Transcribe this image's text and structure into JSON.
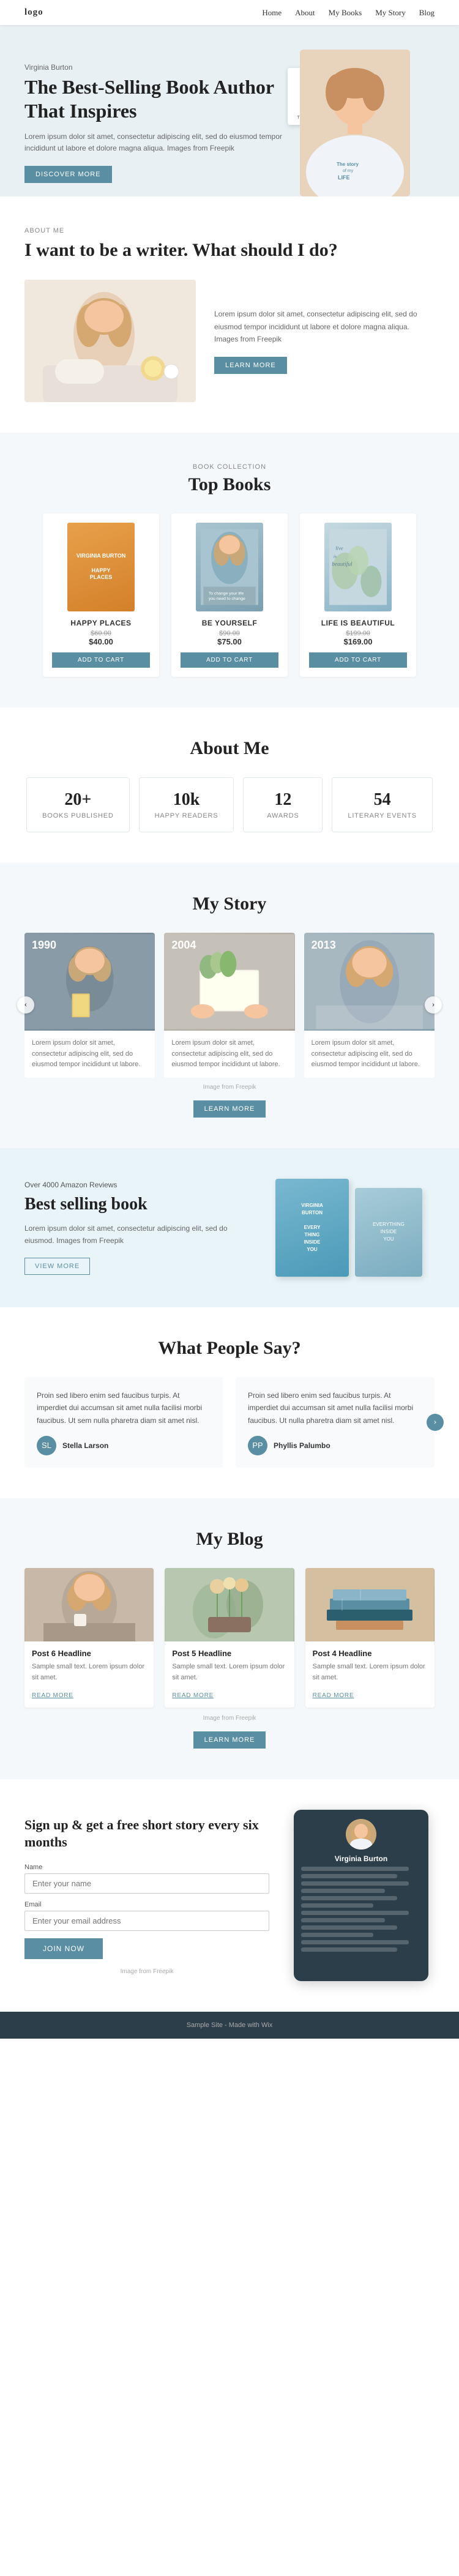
{
  "nav": {
    "logo": "logo",
    "links": [
      "Home",
      "About",
      "My Books",
      "My Story",
      "Blog"
    ]
  },
  "hero": {
    "subtitle": "Virginia Burton",
    "title": "The Best-Selling Book Author That Inspires",
    "body": "Lorem ipsum dolor sit amet, consectetur adipiscing elit, sed do eiusmod tempor incididunt ut labore et dolore magna aliqua. Images from Freepik",
    "cta": "DISCOVER MORE",
    "book_card_text": "The story of my LIFE"
  },
  "about1": {
    "label": "About Me",
    "heading": "I want to be a writer. What should I do?",
    "body": "Lorem ipsum dolor sit amet, consectetur adipiscing elit, sed do eiusmod tempor incididunt ut labore et dolore magna aliqua. Images from Freepik",
    "cta": "LEARN MORE"
  },
  "books": {
    "label": "Book Collection",
    "title": "Top Books",
    "items": [
      {
        "cover_text": "VIRGINIA BURTON\nHAPPY PLACES",
        "name": "HAPPY PLACES",
        "price_old": "$60.00",
        "price_new": "$40.00",
        "cta": "ADD TO CART"
      },
      {
        "cover_text": "To change your life\nyou need to change\nyour priorities",
        "name": "BE YOURSELF",
        "price_old": "$90.00",
        "price_new": "$75.00",
        "cta": "ADD TO CART"
      },
      {
        "cover_text": "live is beautiful",
        "name": "LIFE IS BEAUTIFUL",
        "price_old": "$199.00",
        "price_new": "$169.00",
        "cta": "ADD TO CART"
      }
    ]
  },
  "stats": {
    "title": "About Me",
    "items": [
      {
        "number": "20+",
        "label": "BOOKS PUBLISHED"
      },
      {
        "number": "10k",
        "label": "HAPPY READERS"
      },
      {
        "number": "12",
        "label": "AWARDS"
      },
      {
        "number": "54",
        "label": "LITERARY EVENTS"
      }
    ]
  },
  "story": {
    "title": "My Story",
    "slides": [
      {
        "year": "1990",
        "text": "Lorem ipsum dolor sit amet, consectetur adipiscing elit, sed do eiusmod tempor incididunt ut labore."
      },
      {
        "year": "2004",
        "text": "Lorem ipsum dolor sit amet, consectetur adipiscing elit, sed do eiusmod tempor incididunt ut labore."
      },
      {
        "year": "2013",
        "text": "Lorem ipsum dolor sit amet, consectetur adipiscing elit, sed do eiusmod tempor incididunt ut labore."
      }
    ],
    "image_note": "Image from Freepik",
    "cta": "LEARN MORE"
  },
  "bestsell": {
    "reviews": "Over 4000 Amazon Reviews",
    "title": "Best selling book",
    "body": "Lorem ipsum dolor sit amet, consectetur adipiscing elit, sed do eiusmod. Images from Freepik",
    "cta": "VIEW MORE",
    "book1_text": "VIRGINIA BURTON\n\nEVERYTHING INSIDE YOU",
    "book2_text": "EVERYTHING INSIDE YOU"
  },
  "testimonials": {
    "title": "What People Say?",
    "items": [
      {
        "text": "Proin sed libero enim sed faucibus turpis. At imperdiet dui accumsan sit amet nulla facilisi morbi faucibus. Ut sem nulla pharetra diam sit amet nisl.",
        "author": "Stella Larson",
        "initials": "SL"
      },
      {
        "text": "Proin sed libero enim sed faucibus turpis. At imperdiet dui accumsan sit amet nulla facilisi morbi faucibus. Ut nulla pharetra diam sit amet nisl.",
        "author": "Phyllis Palumbo",
        "initials": "PP"
      }
    ]
  },
  "blog": {
    "title": "My Blog",
    "posts": [
      {
        "headline": "Post 6 Headline",
        "text": "Sample small text. Lorem ipsum dolor sit amet.",
        "cta": "READ MORE"
      },
      {
        "headline": "Post 5 Headline",
        "text": "Sample small text. Lorem ipsum dolor sit amet.",
        "cta": "READ MORE"
      },
      {
        "headline": "Post 4 Headline",
        "text": "Sample small text. Lorem ipsum dolor sit amet.",
        "cta": "READ MORE"
      }
    ],
    "image_note": "Image from Freepik",
    "cta": "LEARN MORE"
  },
  "newsletter": {
    "title": "Sign up & get a free short story every six months",
    "name_label": "Name",
    "name_placeholder": "Enter your name",
    "email_label": "Email",
    "email_placeholder": "Enter your email address",
    "cta": "JOIN NOW",
    "image_note": "Image from Freepik",
    "tablet_name": "Virginia Burton"
  },
  "footer": {
    "text": "Sample Site - Made with Wix"
  }
}
